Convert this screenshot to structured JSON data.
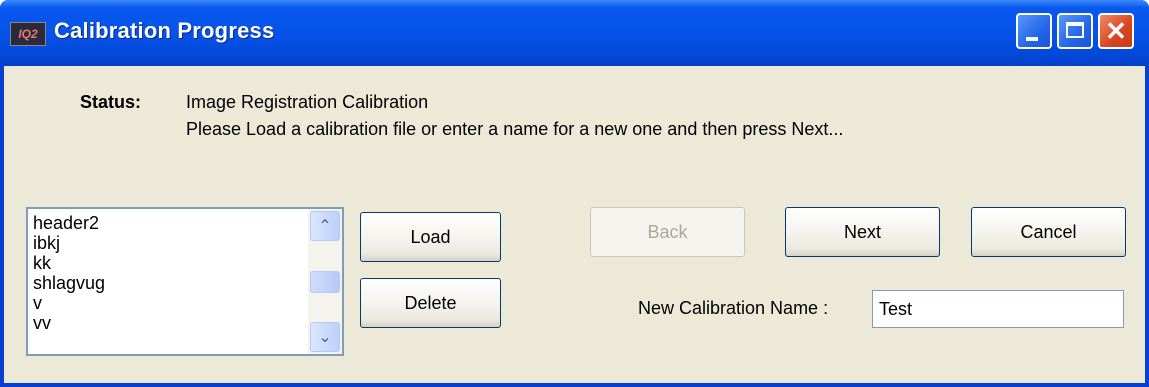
{
  "window": {
    "title": "Calibration Progress",
    "app_icon_text": "IQ2",
    "close_glyph": "✕"
  },
  "status": {
    "label": "Status:",
    "line1": "Image Registration Calibration",
    "line2": "Please Load a calibration file or enter a name for a new one and then press Next..."
  },
  "calibration_list": {
    "items": [
      "header2",
      "ibkj",
      "kk",
      "shlagvug",
      "v",
      "vv"
    ],
    "scroll_up_glyph": "⌃",
    "scroll_down_glyph": "⌄"
  },
  "buttons": {
    "load": "Load",
    "delete": "Delete",
    "back": "Back",
    "next": "Next",
    "cancel": "Cancel"
  },
  "new_name": {
    "label": "New Calibration Name :",
    "value": "Test"
  },
  "colors": {
    "title_bar": "#0653e8",
    "dialog_background": "#ece9d8",
    "close_button": "#d9441e"
  }
}
